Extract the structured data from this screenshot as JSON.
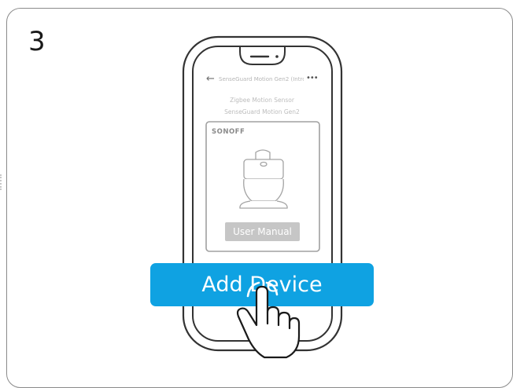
{
  "step": {
    "number": "3"
  },
  "phone": {
    "nav": {
      "back_icon": "arrow-left-icon",
      "title": "SenseGuard Motion Gen2 (Intro...",
      "more_icon": "more-dots-icon"
    },
    "device_type": "Zigbee Motion Sensor",
    "device_model": "SenseGuard Motion Gen2",
    "brand": "SONOFF",
    "manual_button_label": "User Manual"
  },
  "add_device_button_label": "Add Device",
  "colors": {
    "accent": "#0fa2e2",
    "manual_button": "#c6c6c6",
    "outline": "#333333"
  }
}
